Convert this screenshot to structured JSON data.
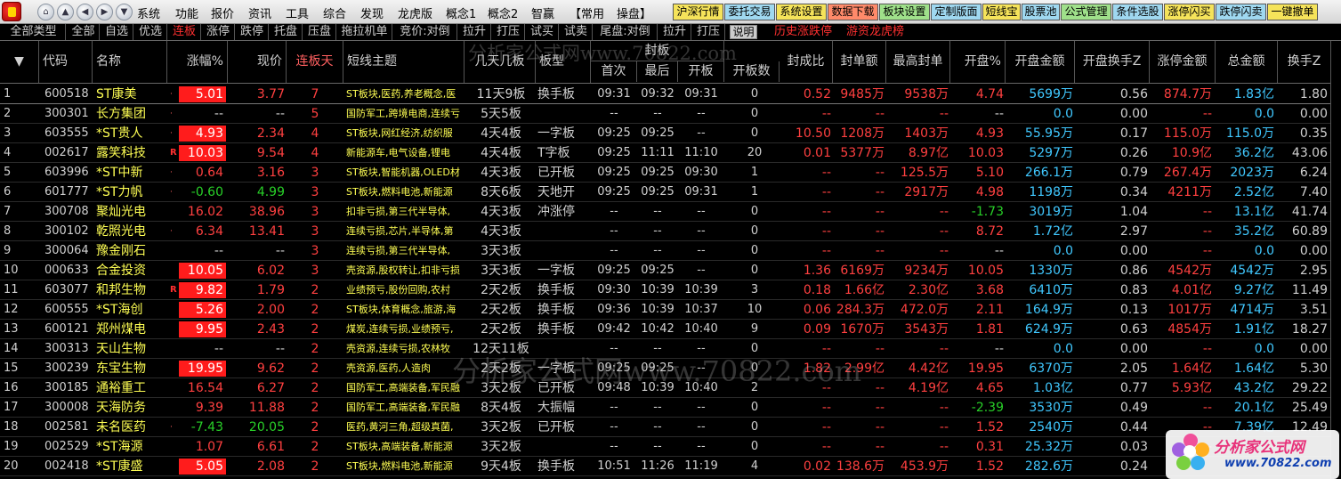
{
  "titlebar": {
    "menus": [
      "系统",
      "功能",
      "报价",
      "资讯",
      "工具",
      "综合",
      "发现",
      "龙虎版",
      "概念1",
      "概念2",
      "智赢",
      "【常用",
      "操盘】"
    ],
    "buttons": [
      {
        "label": "沪深行情",
        "bg": "#f5e35a"
      },
      {
        "label": "委托交易",
        "bg": "#9fd8f0"
      },
      {
        "label": "系统设置",
        "bg": "#f5e35a"
      },
      {
        "label": "数据下载",
        "bg": "#ff8a6a"
      },
      {
        "label": "板块设置",
        "bg": "#9fe08a"
      },
      {
        "label": "定制版面",
        "bg": "#9fd8f0"
      },
      {
        "label": "短线宝",
        "bg": "#f5e35a"
      },
      {
        "label": "股票池",
        "bg": "#9fd8f0"
      },
      {
        "label": "公式管理",
        "bg": "#9fe08a"
      },
      {
        "label": "条件选股",
        "bg": "#9fd8f0"
      },
      {
        "label": "涨停闪买",
        "bg": "#f5e35a"
      },
      {
        "label": "跌停闪卖",
        "bg": "#9fd8f0"
      },
      {
        "label": "一键撤单",
        "bg": "#f5e35a"
      }
    ]
  },
  "filters": {
    "category": "全部类型",
    "tabs": [
      "全部",
      "自选",
      "优选",
      "连板",
      "涨停",
      "跌停",
      "托盘",
      "压盘",
      "拖拉机单",
      "竞价:对倒",
      "拉升",
      "打压",
      "试买",
      "试卖",
      "尾盘:对倒",
      "拉升",
      "打压"
    ],
    "active": "连板",
    "help": "说明",
    "history": "历史涨跌停",
    "hot": "游资龙虎榜"
  },
  "header": {
    "code": "代码",
    "name": "名称",
    "chg": "涨幅%",
    "price": "现价",
    "days": "连板天",
    "topic": "短线主题",
    "board": "几天几板",
    "type": "板型",
    "seal": "封板",
    "t1": "首次",
    "t2": "最后",
    "t3": "开板",
    "cnt": "开板数",
    "ratio": "封成比",
    "samt": "封单额",
    "maxs": "最高封单",
    "open": "开盘%",
    "oamt": "开盘金额",
    "oturn": "开盘换手Z",
    "lamt": "涨停金额",
    "tamt": "总金额",
    "turn": "换手Z"
  },
  "rows": [
    {
      "n": "1",
      "code": "600518",
      "name": "ST康美",
      "mk": "·",
      "chg": "5.01",
      "box": true,
      "price": "3.77",
      "pc": "up",
      "days": "7",
      "topic": "ST板块,医药,养老概念,医",
      "board": "11天9板",
      "type": "换手板",
      "t1": "09:31",
      "t2": "09:32",
      "t3": "09:31",
      "cnt": "0",
      "ratio": "0.52",
      "samt": "9485万",
      "maxs": "9538万",
      "open": "4.74",
      "oc": "up",
      "oamt": "5699万",
      "oturn": "0.56",
      "lamt": "874.7万",
      "tamt": "1.83亿",
      "turn": "1.80"
    },
    {
      "n": "2",
      "code": "300301",
      "name": "长方集团",
      "mk": "·",
      "chg": "--",
      "box": false,
      "cc": "nt",
      "price": "--",
      "pc": "nt",
      "days": "5",
      "topic": "国防军工,跨境电商,连续亏",
      "board": "5天5板",
      "type": "",
      "t1": "--",
      "t2": "--",
      "t3": "--",
      "cnt": "0",
      "ratio": "--",
      "samt": "--",
      "maxs": "--",
      "open": "--",
      "oc": "nt",
      "oamt": "0.0",
      "oturn": "0.00",
      "lamt": "--",
      "tamt": "0.0",
      "turn": "0.00"
    },
    {
      "n": "3",
      "code": "603555",
      "name": "*ST贵人",
      "mk": "·",
      "chg": "4.93",
      "box": true,
      "price": "2.34",
      "pc": "up",
      "days": "4",
      "topic": "ST板块,网红经济,纺织服",
      "board": "4天4板",
      "type": "一字板",
      "t1": "09:25",
      "t2": "09:25",
      "t3": "--",
      "cnt": "0",
      "ratio": "10.50",
      "samt": "1208万",
      "maxs": "1403万",
      "open": "4.93",
      "oc": "up",
      "oamt": "55.95万",
      "oturn": "0.17",
      "lamt": "115.0万",
      "tamt": "115.0万",
      "turn": "0.35"
    },
    {
      "n": "4",
      "code": "002617",
      "name": "露笑科技",
      "mk": "R",
      "chg": "10.03",
      "box": true,
      "price": "9.54",
      "pc": "up",
      "days": "4",
      "topic": "新能源车,电气设备,锂电",
      "board": "4天4板",
      "type": "T字板",
      "t1": "09:25",
      "t2": "11:11",
      "t3": "11:10",
      "cnt": "20",
      "ratio": "0.01",
      "samt": "5377万",
      "maxs": "8.97亿",
      "open": "10.03",
      "oc": "up",
      "oamt": "5297万",
      "oturn": "0.26",
      "lamt": "10.9亿",
      "tamt": "36.2亿",
      "turn": "43.06"
    },
    {
      "n": "5",
      "code": "603996",
      "name": "*ST中新",
      "mk": "·",
      "chg": "0.64",
      "box": false,
      "cc": "up",
      "price": "3.16",
      "pc": "up",
      "days": "3",
      "topic": "ST板块,智能机器,OLED材",
      "board": "4天3板",
      "type": "已开板",
      "t1": "09:25",
      "t2": "09:25",
      "t3": "09:30",
      "cnt": "1",
      "ratio": "--",
      "samt": "--",
      "maxs": "125.5万",
      "open": "5.10",
      "oc": "up",
      "oamt": "266.1万",
      "oturn": "0.79",
      "lamt": "267.4万",
      "tamt": "2023万",
      "turn": "6.24"
    },
    {
      "n": "6",
      "code": "601777",
      "name": "*ST力帆",
      "mk": "·",
      "chg": "-0.60",
      "box": false,
      "cc": "dn",
      "price": "4.99",
      "pc": "dn",
      "days": "3",
      "topic": "ST板块,燃料电池,新能源",
      "board": "8天6板",
      "type": "天地开",
      "t1": "09:25",
      "t2": "09:25",
      "t3": "09:31",
      "cnt": "1",
      "ratio": "--",
      "samt": "--",
      "maxs": "2917万",
      "open": "4.98",
      "oc": "up",
      "oamt": "1198万",
      "oturn": "0.34",
      "lamt": "4211万",
      "tamt": "2.52亿",
      "turn": "7.40"
    },
    {
      "n": "7",
      "code": "300708",
      "name": "聚灿光电",
      "mk": "",
      "chg": "16.02",
      "box": false,
      "cc": "up",
      "price": "38.96",
      "pc": "up",
      "days": "3",
      "topic": "扣非亏损,第三代半导体,",
      "board": "4天3板",
      "type": "冲涨停",
      "t1": "--",
      "t2": "--",
      "t3": "--",
      "cnt": "0",
      "ratio": "--",
      "samt": "--",
      "maxs": "--",
      "open": "-1.73",
      "oc": "dn",
      "oamt": "3019万",
      "oturn": "1.04",
      "lamt": "--",
      "tamt": "13.1亿",
      "turn": "41.74"
    },
    {
      "n": "8",
      "code": "300102",
      "name": "乾照光电",
      "mk": "·",
      "chg": "6.34",
      "box": false,
      "cc": "up",
      "price": "13.41",
      "pc": "up",
      "days": "3",
      "topic": "连续亏损,芯片,半导体,第",
      "board": "4天3板",
      "type": "",
      "t1": "--",
      "t2": "--",
      "t3": "--",
      "cnt": "0",
      "ratio": "--",
      "samt": "--",
      "maxs": "--",
      "open": "8.72",
      "oc": "up",
      "oamt": "1.72亿",
      "oturn": "2.97",
      "lamt": "--",
      "tamt": "35.2亿",
      "turn": "60.89"
    },
    {
      "n": "9",
      "code": "300064",
      "name": "豫金刚石",
      "mk": "",
      "chg": "--",
      "box": false,
      "cc": "nt",
      "price": "--",
      "pc": "nt",
      "days": "3",
      "topic": "连续亏损,第三代半导体,",
      "board": "3天3板",
      "type": "",
      "t1": "--",
      "t2": "--",
      "t3": "--",
      "cnt": "0",
      "ratio": "--",
      "samt": "--",
      "maxs": "--",
      "open": "--",
      "oc": "nt",
      "oamt": "0.0",
      "oturn": "0.00",
      "lamt": "--",
      "tamt": "0.0",
      "turn": "0.00"
    },
    {
      "n": "10",
      "code": "000633",
      "name": "合金投资",
      "mk": "",
      "chg": "10.05",
      "box": true,
      "price": "6.02",
      "pc": "up",
      "days": "3",
      "topic": "壳资源,股权转让,扣非亏损",
      "board": "3天3板",
      "type": "一字板",
      "t1": "09:25",
      "t2": "09:25",
      "t3": "--",
      "cnt": "0",
      "ratio": "1.36",
      "samt": "6169万",
      "maxs": "9234万",
      "open": "10.05",
      "oc": "up",
      "oamt": "1330万",
      "oturn": "0.86",
      "lamt": "4542万",
      "tamt": "4542万",
      "turn": "2.95"
    },
    {
      "n": "11",
      "code": "603077",
      "name": "和邦生物",
      "mk": "R",
      "chg": "9.82",
      "box": true,
      "price": "1.79",
      "pc": "up",
      "days": "2",
      "topic": "业绩预亏,股份回购,农村",
      "board": "2天2板",
      "type": "换手板",
      "t1": "09:30",
      "t2": "10:39",
      "t3": "10:39",
      "cnt": "3",
      "ratio": "0.18",
      "samt": "1.66亿",
      "maxs": "2.30亿",
      "open": "3.68",
      "oc": "up",
      "oamt": "6410万",
      "oturn": "0.83",
      "lamt": "4.01亿",
      "tamt": "9.27亿",
      "turn": "11.49"
    },
    {
      "n": "12",
      "code": "600555",
      "name": "*ST海创",
      "mk": "",
      "chg": "5.26",
      "box": true,
      "price": "2.00",
      "pc": "up",
      "days": "2",
      "topic": "ST板块,体育概念,旅游,海",
      "board": "2天2板",
      "type": "换手板",
      "t1": "09:36",
      "t2": "10:39",
      "t3": "10:37",
      "cnt": "10",
      "ratio": "0.06",
      "samt": "284.3万",
      "maxs": "472.0万",
      "open": "2.11",
      "oc": "up",
      "oamt": "164.9万",
      "oturn": "0.13",
      "lamt": "1017万",
      "tamt": "4714万",
      "turn": "3.51"
    },
    {
      "n": "13",
      "code": "600121",
      "name": "郑州煤电",
      "mk": "",
      "chg": "9.95",
      "box": true,
      "price": "2.43",
      "pc": "up",
      "days": "2",
      "topic": "煤炭,连续亏损,业绩预亏,",
      "board": "2天2板",
      "type": "换手板",
      "t1": "09:42",
      "t2": "10:42",
      "t3": "10:40",
      "cnt": "9",
      "ratio": "0.09",
      "samt": "1670万",
      "maxs": "3543万",
      "open": "1.81",
      "oc": "up",
      "oamt": "624.9万",
      "oturn": "0.63",
      "lamt": "4854万",
      "tamt": "1.91亿",
      "turn": "18.27"
    },
    {
      "n": "14",
      "code": "300313",
      "name": "天山生物",
      "mk": "",
      "chg": "--",
      "box": false,
      "cc": "nt",
      "price": "--",
      "pc": "nt",
      "days": "2",
      "topic": "壳资源,连续亏损,农林牧",
      "board": "12天11板",
      "type": "",
      "t1": "--",
      "t2": "--",
      "t3": "--",
      "cnt": "0",
      "ratio": "--",
      "samt": "--",
      "maxs": "--",
      "open": "--",
      "oc": "nt",
      "oamt": "0.0",
      "oturn": "0.00",
      "lamt": "--",
      "tamt": "0.0",
      "turn": "0.00"
    },
    {
      "n": "15",
      "code": "300239",
      "name": "东宝生物",
      "mk": "",
      "chg": "19.95",
      "box": true,
      "price": "9.62",
      "pc": "up",
      "days": "2",
      "topic": "壳资源,医药,人造肉",
      "board": "2天2板",
      "type": "一字板",
      "t1": "09:25",
      "t2": "09:25",
      "t3": "--",
      "cnt": "0",
      "ratio": "1.82",
      "samt": "2.99亿",
      "maxs": "4.42亿",
      "open": "19.95",
      "oc": "up",
      "oamt": "6370万",
      "oturn": "2.05",
      "lamt": "1.64亿",
      "tamt": "1.64亿",
      "turn": "5.30"
    },
    {
      "n": "16",
      "code": "300185",
      "name": "通裕重工",
      "mk": "",
      "chg": "16.54",
      "box": false,
      "cc": "up",
      "price": "6.27",
      "pc": "up",
      "days": "2",
      "topic": "国防军工,高端装备,军民融",
      "board": "3天2板",
      "type": "已开板",
      "t1": "09:48",
      "t2": "10:39",
      "t3": "10:40",
      "cnt": "2",
      "ratio": "--",
      "samt": "--",
      "maxs": "4.19亿",
      "open": "4.65",
      "oc": "up",
      "oamt": "1.03亿",
      "oturn": "0.77",
      "lamt": "5.93亿",
      "tamt": "43.2亿",
      "turn": "29.22"
    },
    {
      "n": "17",
      "code": "300008",
      "name": "天海防务",
      "mk": "",
      "chg": "9.39",
      "box": false,
      "cc": "up",
      "price": "11.88",
      "pc": "up",
      "days": "2",
      "topic": "国防军工,高端装备,军民融",
      "board": "8天4板",
      "type": "大振幅",
      "t1": "--",
      "t2": "--",
      "t3": "--",
      "cnt": "0",
      "ratio": "--",
      "samt": "--",
      "maxs": "--",
      "open": "-2.39",
      "oc": "dn",
      "oamt": "3530万",
      "oturn": "0.49",
      "lamt": "--",
      "tamt": "20.1亿",
      "turn": "25.49"
    },
    {
      "n": "18",
      "code": "002581",
      "name": "未名医药",
      "mk": "·",
      "chg": "-7.43",
      "box": false,
      "cc": "dn",
      "price": "20.05",
      "pc": "dn",
      "days": "2",
      "topic": "医药,黄河三角,超级真菌,",
      "board": "3天2板",
      "type": "已开板",
      "t1": "--",
      "t2": "--",
      "t3": "--",
      "cnt": "0",
      "ratio": "--",
      "samt": "--",
      "maxs": "--",
      "open": "1.52",
      "oc": "up",
      "oamt": "2540万",
      "oturn": "0.44",
      "lamt": "--",
      "tamt": "7.39亿",
      "turn": "12.49"
    },
    {
      "n": "19",
      "code": "002529",
      "name": "*ST海源",
      "mk": "",
      "chg": "1.07",
      "box": false,
      "cc": "up",
      "price": "6.61",
      "pc": "up",
      "days": "2",
      "topic": "ST板块,高端装备,新能源",
      "board": "3天2板",
      "type": "",
      "t1": "--",
      "t2": "--",
      "t3": "--",
      "cnt": "0",
      "ratio": "--",
      "samt": "--",
      "maxs": "--",
      "open": "0.31",
      "oc": "up",
      "oamt": "25.32万",
      "oturn": "0.03",
      "lamt": "--",
      "tamt": "",
      "turn": ""
    },
    {
      "n": "20",
      "code": "002418",
      "name": "*ST康盛",
      "mk": "",
      "chg": "5.05",
      "box": true,
      "price": "2.08",
      "pc": "up",
      "days": "2",
      "topic": "ST板块,燃料电池,新能源",
      "board": "9天4板",
      "type": "换手板",
      "t1": "10:51",
      "t2": "11:26",
      "t3": "11:19",
      "cnt": "4",
      "ratio": "0.02",
      "samt": "138.6万",
      "maxs": "453.9万",
      "open": "1.52",
      "oc": "up",
      "oamt": "282.6万",
      "oturn": "0.24",
      "lamt": "",
      "tamt": "",
      "turn": ""
    }
  ],
  "watermark": {
    "top": "分析家公式网www.70822.com",
    "mid": "分析家公式网www.70822.com"
  },
  "brand": {
    "name": "分析家公式网",
    "url": "www.70822.com"
  }
}
